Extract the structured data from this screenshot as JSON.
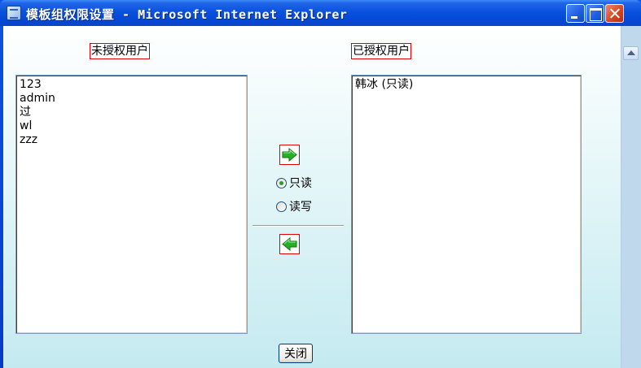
{
  "window": {
    "title": "模板组权限设置 - Microsoft Internet Explorer",
    "icons": {
      "app": "ie-page-icon",
      "minimize": "minimize-icon",
      "maximize": "maximize-icon",
      "close": "close-icon"
    }
  },
  "left_panel": {
    "label": "未授权用户",
    "items": [
      {
        "label": "123"
      },
      {
        "label": "admin"
      },
      {
        "label": "过"
      },
      {
        "label": "wl"
      },
      {
        "label": "zzz"
      }
    ]
  },
  "right_panel": {
    "label": "已授权用户",
    "items": [
      {
        "label": "韩冰 (只读)"
      }
    ]
  },
  "controls": {
    "add_icon": "arrow-right-icon",
    "remove_icon": "arrow-left-icon",
    "arrow_color": "#26b026",
    "permissions": [
      {
        "label": "只读",
        "checked": true
      },
      {
        "label": "读写",
        "checked": false
      }
    ],
    "close_label": "关闭"
  },
  "colors": {
    "titlebar": "#0a52dd",
    "highlight_border": "#e00000",
    "client_bottom": "#c4eaf0"
  }
}
